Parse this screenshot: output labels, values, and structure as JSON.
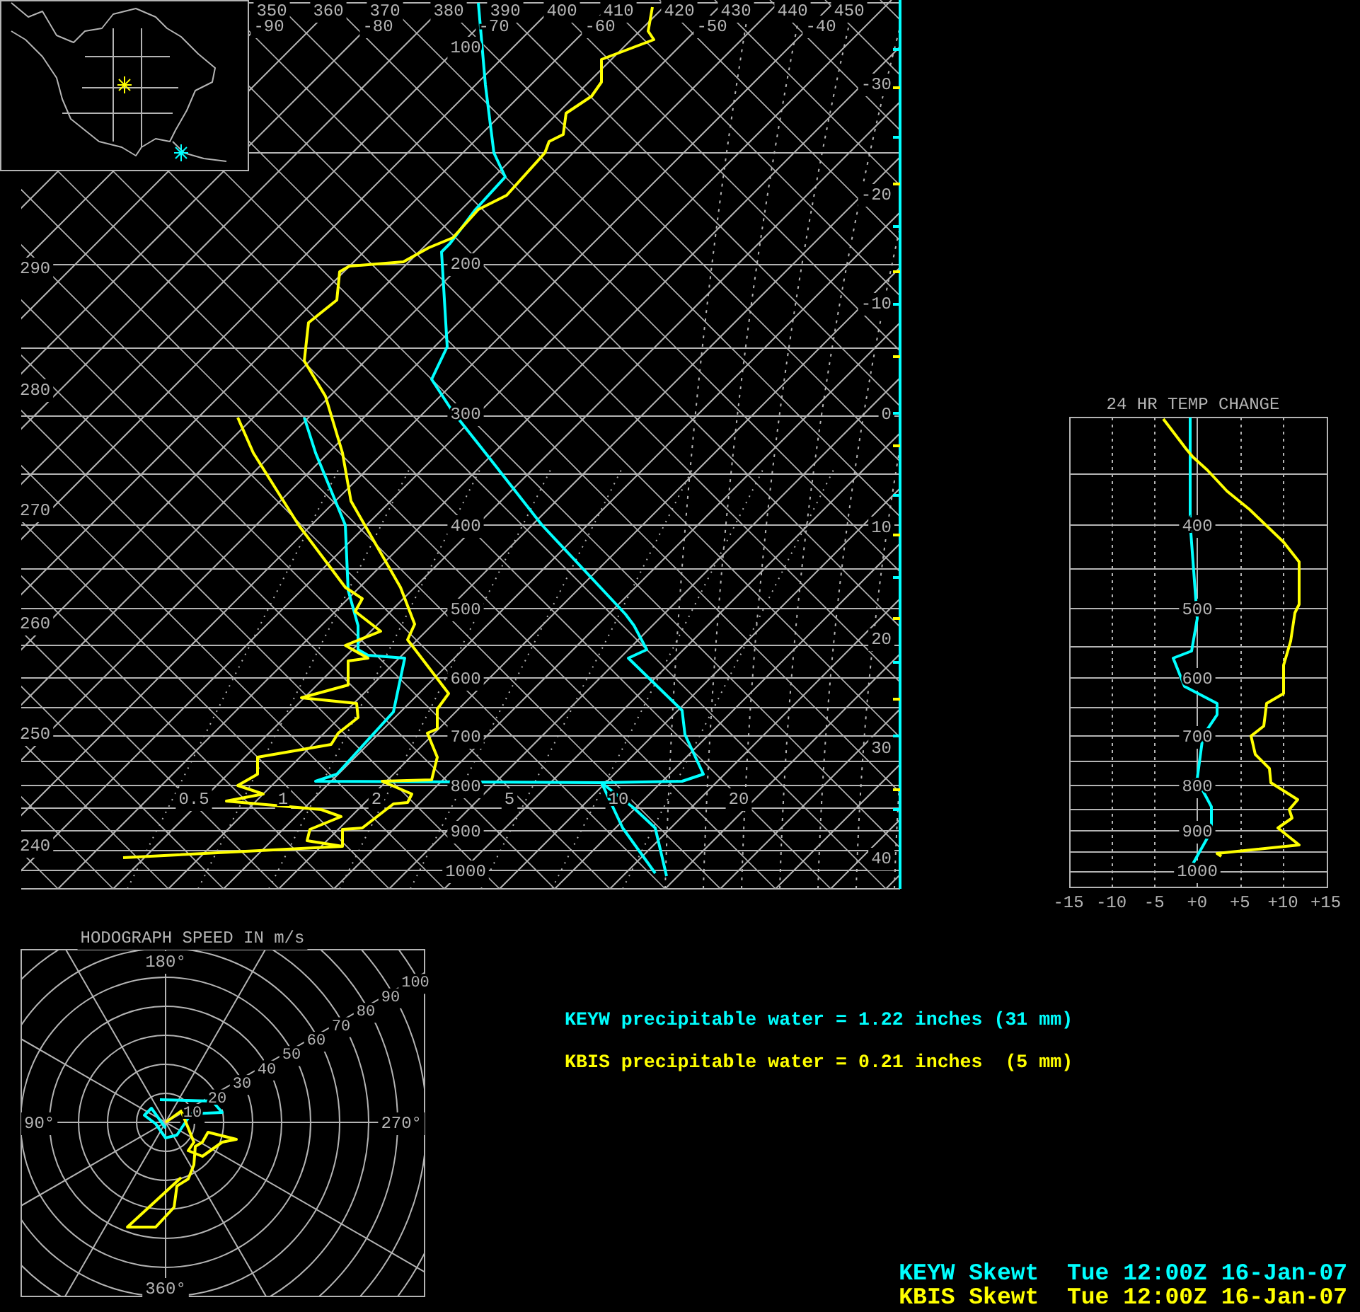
{
  "skewt": {
    "theta_top_labels": [
      "350",
      "360",
      "370",
      "380",
      "390",
      "400",
      "410",
      "420",
      "430",
      "440",
      "450"
    ],
    "temperature_top_labels": [
      "-90",
      "-80",
      "-70",
      "-60",
      "-50",
      "-40"
    ],
    "theta_left_labels": [
      "290",
      "280",
      "270",
      "260",
      "250",
      "240"
    ],
    "temperature_right_labels": [
      "-30",
      "-20",
      "-10",
      "0",
      "10",
      "20",
      "30",
      "40"
    ],
    "pressure_labels": [
      "100",
      "200",
      "300",
      "400",
      "500",
      "600",
      "700",
      "800",
      "900",
      "1000"
    ],
    "mixing_ratio_labels": [
      "0.5",
      "1",
      "2",
      "5",
      "10",
      "20"
    ]
  },
  "temp_change": {
    "title": "24 HR TEMP CHANGE",
    "pressure_labels": [
      "400",
      "500",
      "600",
      "700",
      "800",
      "900",
      "1000"
    ],
    "x_labels": [
      "-15",
      "-10",
      "-5",
      "+0",
      "+5",
      "+10",
      "+15"
    ]
  },
  "hodograph": {
    "title": "HODOGRAPH  SPEED  IN  m/s",
    "direction_labels": [
      "180°",
      "90°",
      "270°",
      "360°"
    ],
    "speed_labels": [
      "10",
      "20",
      "30",
      "40",
      "50",
      "60",
      "70",
      "80",
      "90",
      "100"
    ]
  },
  "stations": [
    {
      "color": "#00ffff",
      "precipitable_water": "KEYW precipitable water = 1.22 inches (31 mm)",
      "caption": "KEYW Skewt  Tue 12:00Z 16-Jan-07"
    },
    {
      "color": "#ffff00",
      "precipitable_water": "KBIS precipitable water = 0.21 inches  (5 mm)",
      "caption": "KBIS Skewt  Tue 12:00Z 16-Jan-07"
    }
  ]
}
